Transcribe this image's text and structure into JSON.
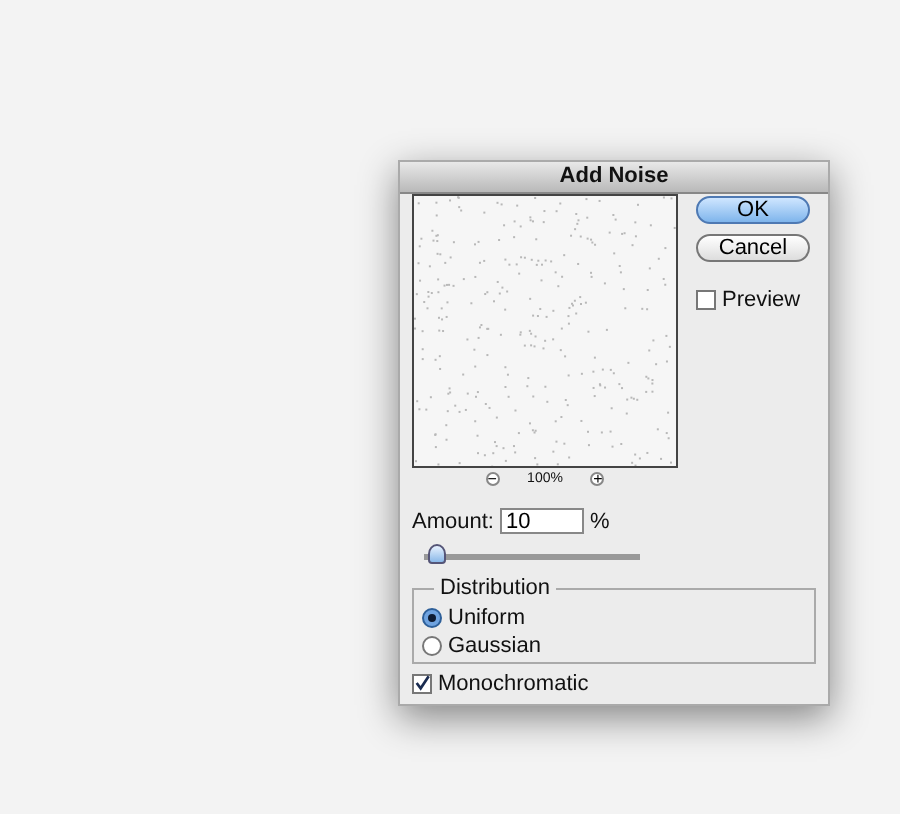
{
  "window": {
    "title": "Add Noise"
  },
  "buttons": [
    {
      "label": "OK",
      "default": true
    },
    {
      "label": "Cancel",
      "default": false
    }
  ],
  "preview_checkbox": {
    "label": "Preview",
    "checked": false
  },
  "zoom": {
    "out": "−",
    "level": "100%",
    "in": "+"
  },
  "amount": {
    "label": "Amount:",
    "value": "10",
    "unit": "%",
    "level": 0.025
  },
  "distribution": {
    "title": "Distribution",
    "options": [
      {
        "label": "Uniform",
        "selected": true
      },
      {
        "label": "Gaussian",
        "selected": false
      }
    ]
  },
  "monochromatic": {
    "label": "Monochromatic",
    "checked": true
  }
}
